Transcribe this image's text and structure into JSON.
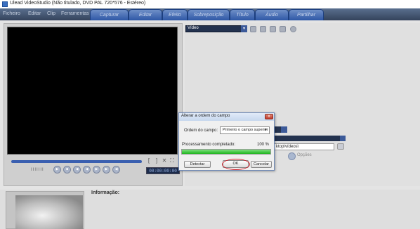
{
  "window": {
    "title": "Ulead VideoStudio (Não titulado, DVD PAL 720*576 - Estéreo)"
  },
  "menu": {
    "items": [
      "Ficheiro",
      "Editar",
      "Clip",
      "Ferramentas"
    ]
  },
  "steps": [
    "Capturar",
    "Editar",
    "Efeito",
    "Sobreposição",
    "Título",
    "Áudio",
    "Partilhar"
  ],
  "options_panel": {
    "dropdown_value": "Vídeo",
    "path_value": "ktop\\vídeos\\",
    "options_label": "Opções"
  },
  "player": {
    "timecode": "00:00:00:00",
    "speed_ticks": "IIIIIII"
  },
  "info": {
    "label": "Informação:"
  },
  "dialog": {
    "title": "Alterar a ordem do campo",
    "close_label": "x",
    "field_order_label": "Ordem do campo:",
    "field_order_value": "Primeiro o campo superior",
    "progress_label": "Processamento completado:",
    "progress_percent": "100  %",
    "progress_fraction": 1.0,
    "buttons": {
      "detect": "Detectar",
      "ok": "OK",
      "cancel": "Cancelar"
    }
  },
  "colors": {
    "accent": "#2e57a6",
    "progress": "#1fb51f",
    "highlight": "#d0202a"
  }
}
